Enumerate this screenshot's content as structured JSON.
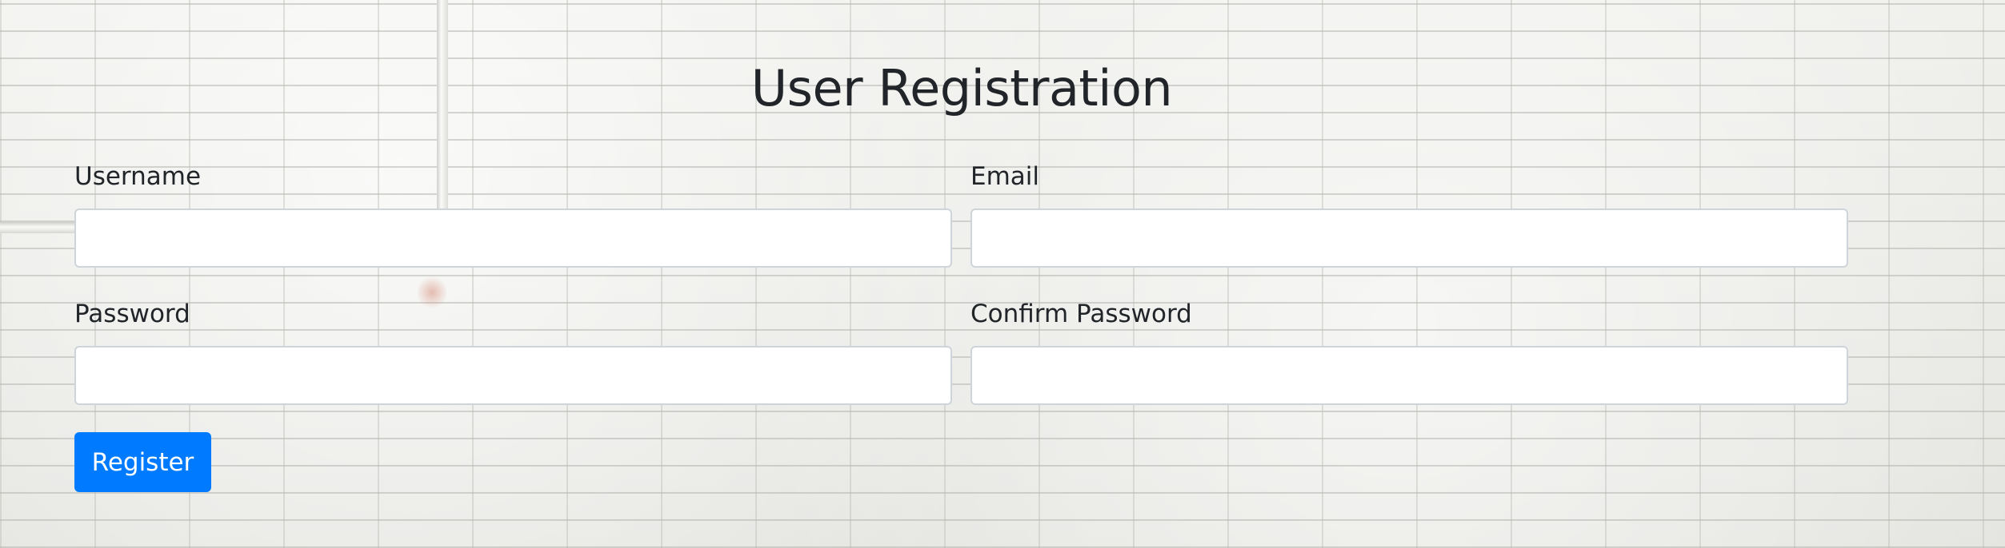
{
  "page": {
    "title": "User Registration"
  },
  "form": {
    "fields": {
      "username": {
        "label": "Username",
        "value": "",
        "placeholder": ""
      },
      "email": {
        "label": "Email",
        "value": "",
        "placeholder": ""
      },
      "password": {
        "label": "Password",
        "value": "",
        "placeholder": ""
      },
      "confirm_password": {
        "label": "Confirm Password",
        "value": "",
        "placeholder": ""
      }
    },
    "submit_label": "Register"
  },
  "colors": {
    "primary": "#007bff",
    "text": "#212529",
    "input_border": "#ced4da"
  }
}
